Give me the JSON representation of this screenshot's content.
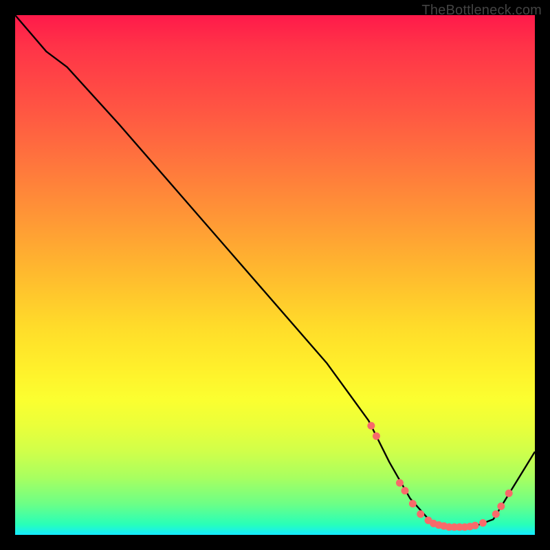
{
  "attribution": "TheBottleneck.com",
  "chart_data": {
    "type": "line",
    "title": "",
    "xlabel": "",
    "ylabel": "",
    "xlim": [
      0,
      100
    ],
    "ylim": [
      0,
      100
    ],
    "series": [
      {
        "name": "curve",
        "x": [
          0,
          6,
          10,
          20,
          30,
          40,
          50,
          60,
          68,
          72,
          76,
          80,
          84,
          88,
          92,
          100
        ],
        "y": [
          100,
          93,
          90,
          79,
          67.5,
          56,
          44.5,
          33,
          22,
          14,
          7,
          2.5,
          1.5,
          1.5,
          3,
          16
        ]
      }
    ],
    "markers": {
      "name": "highlight-dots",
      "color": "#f86a6a",
      "points": [
        {
          "x": 68.5,
          "y": 21
        },
        {
          "x": 69.5,
          "y": 19
        },
        {
          "x": 74,
          "y": 10
        },
        {
          "x": 75,
          "y": 8.5
        },
        {
          "x": 76.5,
          "y": 6
        },
        {
          "x": 78,
          "y": 4
        },
        {
          "x": 79.5,
          "y": 2.8
        },
        {
          "x": 80.5,
          "y": 2.2
        },
        {
          "x": 81.5,
          "y": 1.9
        },
        {
          "x": 82.5,
          "y": 1.7
        },
        {
          "x": 83.5,
          "y": 1.5
        },
        {
          "x": 84.5,
          "y": 1.5
        },
        {
          "x": 85.5,
          "y": 1.5
        },
        {
          "x": 86.5,
          "y": 1.5
        },
        {
          "x": 87.5,
          "y": 1.6
        },
        {
          "x": 88.5,
          "y": 1.8
        },
        {
          "x": 90,
          "y": 2.3
        },
        {
          "x": 92.5,
          "y": 4
        },
        {
          "x": 93.5,
          "y": 5.5
        },
        {
          "x": 95,
          "y": 8
        }
      ]
    }
  }
}
